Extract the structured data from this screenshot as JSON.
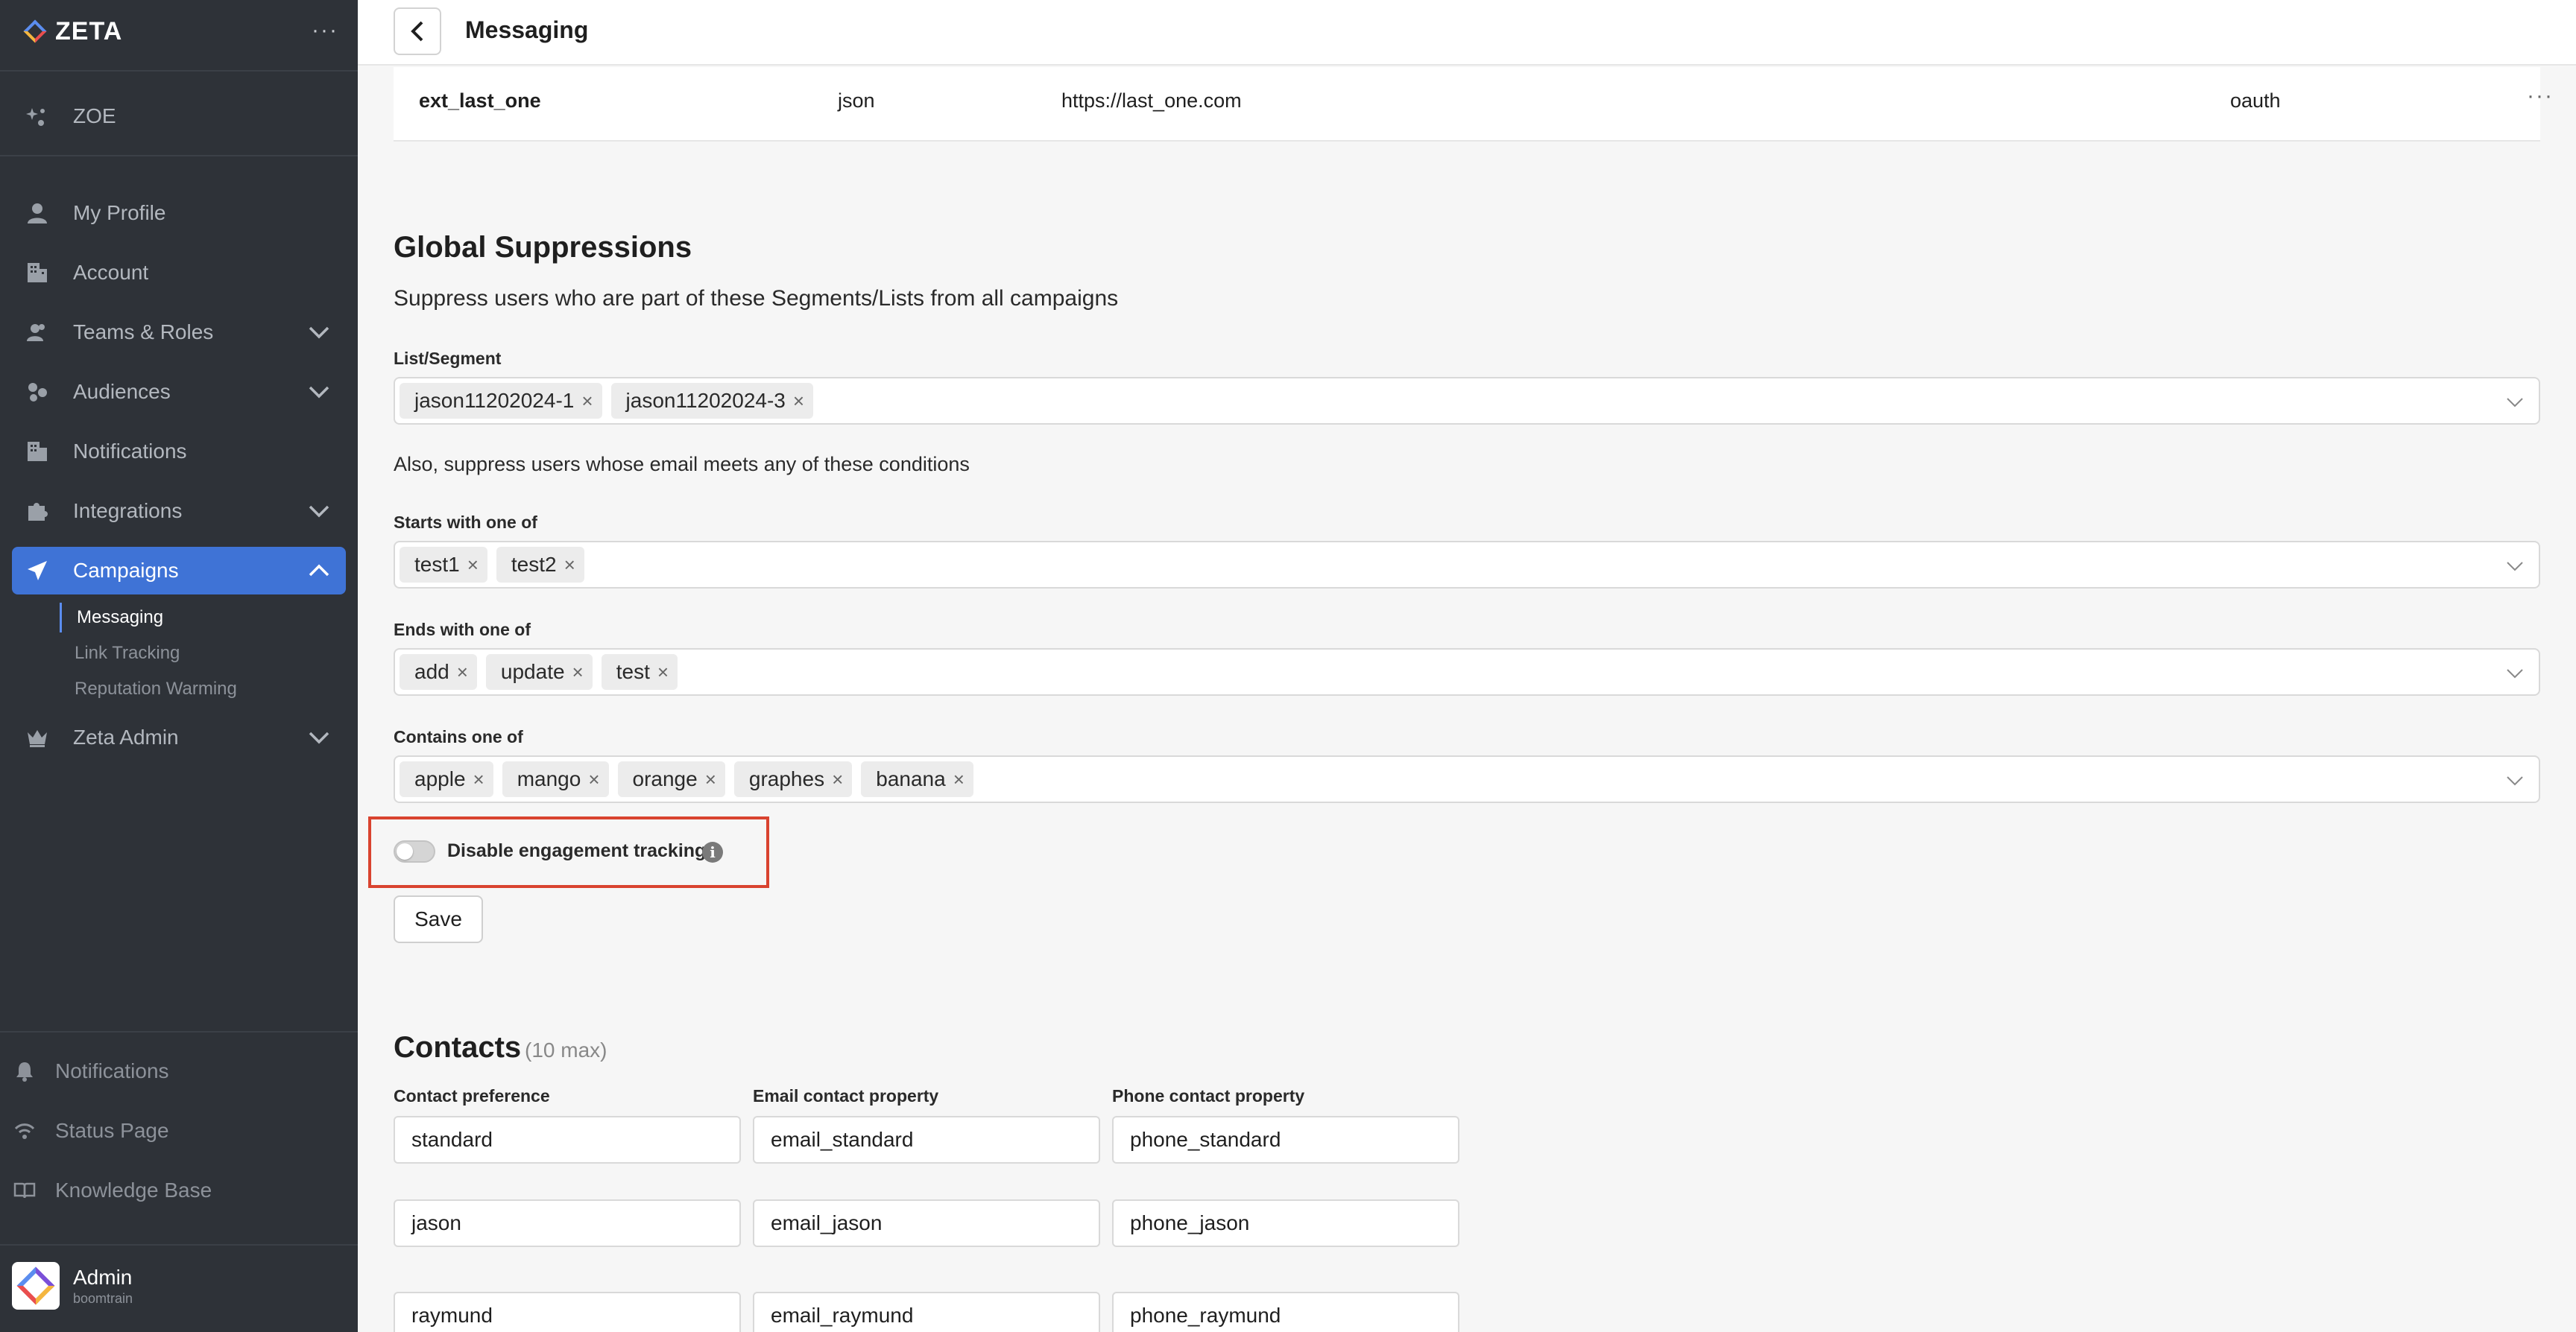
{
  "brand": {
    "name": "ZETA",
    "more": "···"
  },
  "sidebar": {
    "zoe": "ZOE",
    "items": [
      {
        "label": "My Profile"
      },
      {
        "label": "Account"
      },
      {
        "label": "Teams & Roles"
      },
      {
        "label": "Audiences"
      },
      {
        "label": "Notifications"
      },
      {
        "label": "Integrations"
      },
      {
        "label": "Campaigns"
      },
      {
        "label": "Zeta Admin"
      }
    ],
    "campaign_sub": [
      {
        "label": "Messaging"
      },
      {
        "label": "Link Tracking"
      },
      {
        "label": "Reputation Warming"
      }
    ],
    "footer": [
      {
        "label": "Notifications"
      },
      {
        "label": "Status Page"
      },
      {
        "label": "Knowledge Base"
      }
    ],
    "user": {
      "name": "Admin",
      "org": "boomtrain"
    }
  },
  "header": {
    "title": "Messaging"
  },
  "extensions_row": {
    "name": "ext_last_one",
    "type": "json",
    "url": "https://last_one.com",
    "auth": "oauth",
    "more": "···"
  },
  "global_suppressions": {
    "title": "Global Suppressions",
    "description": "Suppress users who are part of these Segments/Lists from all campaigns",
    "list_segment_label": "List/Segment",
    "list_segment_values": [
      "jason11202024-1",
      "jason11202024-3"
    ],
    "email_note": "Also, suppress users whose email meets any of these conditions",
    "starts_with_label": "Starts with one of",
    "starts_with_values": [
      "test1",
      "test2"
    ],
    "ends_with_label": "Ends with one of",
    "ends_with_values": [
      "add",
      "update",
      "test"
    ],
    "contains_label": "Contains one of",
    "contains_values": [
      "apple",
      "mango",
      "orange",
      "graphes",
      "banana"
    ],
    "disable_tracking_label": "Disable engagement tracking",
    "disable_tracking_on": false,
    "save_label": "Save"
  },
  "contacts": {
    "title": "Contacts",
    "max_note": "(10 max)",
    "columns": [
      "Contact preference",
      "Email contact property",
      "Phone contact property"
    ],
    "rows": [
      [
        "standard",
        "email_standard",
        "phone_standard"
      ],
      [
        "jason",
        "email_jason",
        "phone_jason"
      ],
      [
        "raymund",
        "email_raymund",
        "phone_raymund"
      ]
    ]
  },
  "chip_remove_glyph": "×",
  "colors": {
    "sidebar_bg": "#2e3238",
    "active_blue": "#3f73d6",
    "highlight_red": "#d9432f"
  }
}
